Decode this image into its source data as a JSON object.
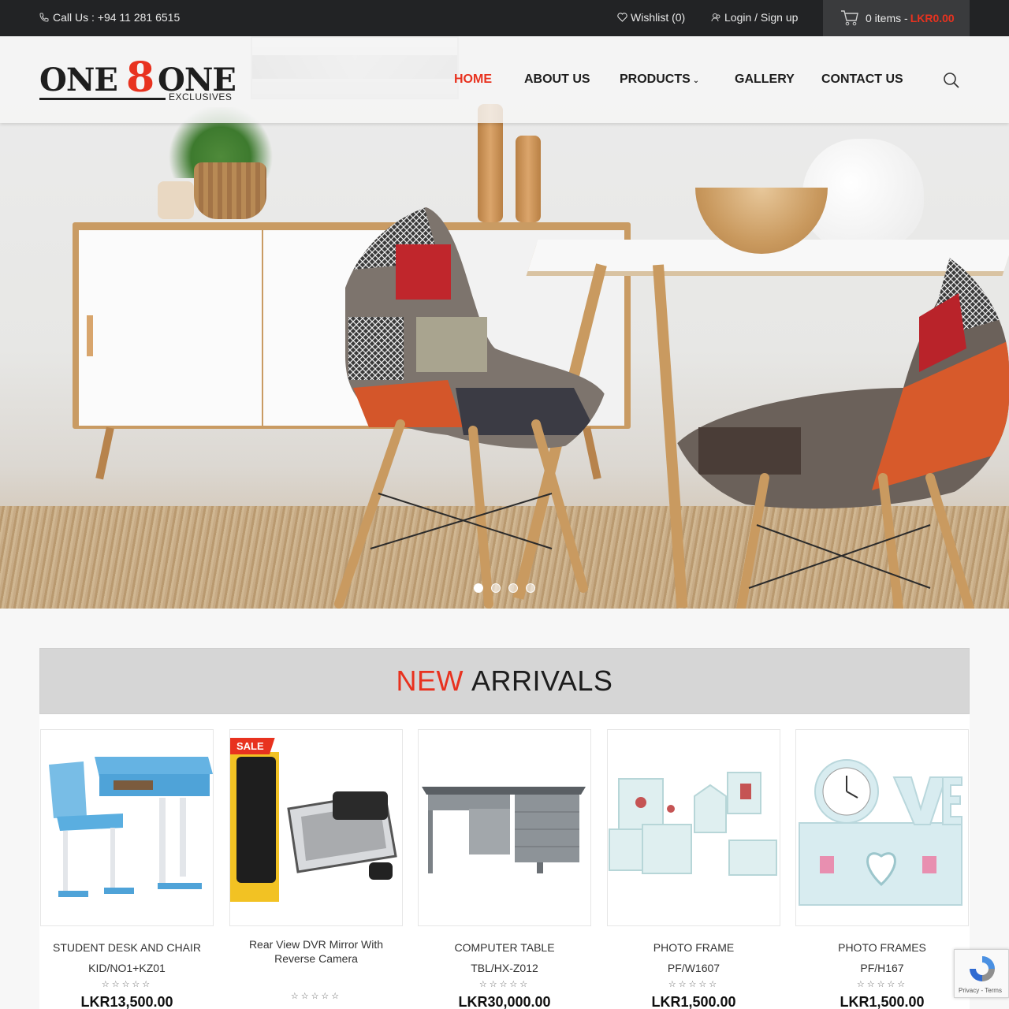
{
  "topbar": {
    "call": "Call Us : +94 11 281 6515",
    "wishlist": "Wishlist (0)",
    "login": "Login / Sign up",
    "cart_items": "0 items -",
    "cart_amount": "LKR0.00"
  },
  "brand": {
    "word1": "ONE",
    "digit": "8",
    "word2": "ONE",
    "tagline": "EXCLUSIVES"
  },
  "nav": {
    "home": "HOME",
    "about": "ABOUT US",
    "products": "PRODUCTS",
    "gallery": "GALLERY",
    "contact": "CONTACT US"
  },
  "hero": {
    "slides": 4,
    "active_slide": 1
  },
  "arrivals": {
    "title_highlight": "NEW",
    "title_rest": "ARRIVALS",
    "products": [
      {
        "name": "STUDENT DESK AND CHAIR",
        "code": "KID/NO1+KZ01",
        "price": "LKR13,500.00",
        "sale": ""
      },
      {
        "name": "Rear View DVR Mirror With Reverse Camera",
        "code": "",
        "price": "",
        "sale": "SALE"
      },
      {
        "name": "COMPUTER TABLE",
        "code": "TBL/HX-Z012",
        "price": "LKR30,000.00",
        "sale": ""
      },
      {
        "name": "PHOTO FRAME",
        "code": "PF/W1607",
        "price": "LKR1,500.00",
        "sale": ""
      },
      {
        "name": "PHOTO FRAMES",
        "code": "PF/H167",
        "price": "LKR1,500.00",
        "sale": ""
      }
    ],
    "stars": "☆☆☆☆☆"
  },
  "recaptcha": {
    "text": "Privacy - Terms"
  },
  "colors": {
    "accent": "#e8321f",
    "topbar": "#222325",
    "cart_bg": "#3a3b3d"
  }
}
